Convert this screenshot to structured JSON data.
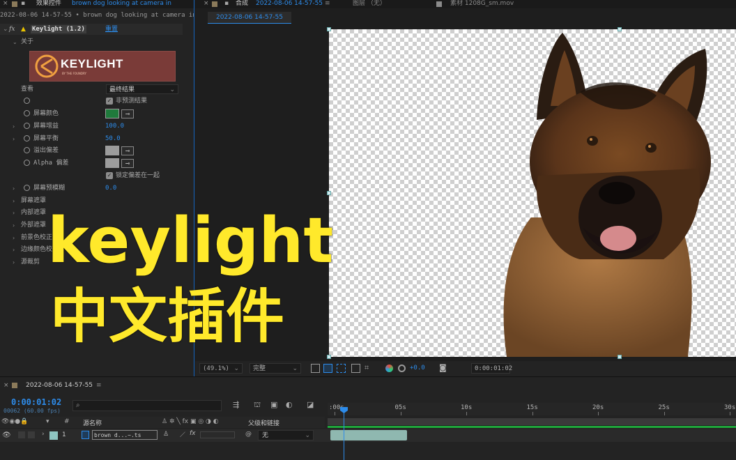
{
  "effect_controls": {
    "tab_label": "效果控件",
    "tab_source": "brown dog looking at camera in",
    "subtitle": "2022-08-06 14-57-55 • brown dog looking at camera in",
    "effect_name": "Keylight (1.2)",
    "reset_label": "重置",
    "about_label": "关于",
    "logo_text": "KEYLIGHT",
    "logo_subtext": "BY THE FOUNDRY",
    "view_label": "查看",
    "view_value": "最终结果",
    "unpremultiply_label": "非预测结果",
    "screen_colour_label": "屏幕颜色",
    "screen_colour": "#1f7a3c",
    "screen_gain_label": "屏幕增益",
    "screen_gain_value": "100.0",
    "screen_balance_label": "屏幕平衡",
    "screen_balance_value": "50.0",
    "despill_bias_label": "溢出偏差",
    "alpha_bias_label": "Alpha 偏差",
    "lock_biases_label": "锁定偏差在一起",
    "screen_preblur_label": "屏幕预模糊",
    "screen_preblur_value": "0.0",
    "screen_matte_label": "屏幕遮罩",
    "inside_mask_label": "内部遮罩",
    "outside_mask_label": "外部遮罩",
    "fg_colour_correction_label": "前景色校正",
    "edge_colour_correction_label": "边缘颜色校正",
    "source_crops_label": "源裁剪"
  },
  "composition": {
    "tab_label": "合成",
    "tab_comp_name": "2022-08-06 14-57-55",
    "layer_tab_label": "图层 （无）",
    "footage_tab_label": "素材 1208G_sm.mov",
    "subtab": "2022-08-06 14-57-55",
    "zoom": "(49.1%)",
    "resolution": "完整",
    "exposure": "+0.0",
    "timecode": "0:00:01:02"
  },
  "timeline": {
    "comp_tab": "2022-08-06 14-57-55",
    "current_time": "0:00:01:02",
    "frame_info": "00062 (60.00 fps)",
    "search_placeholder": "",
    "column_source_name": "源名称",
    "column_parent": "父级和链接",
    "layer_number": "1",
    "layer_name": "brown d...~.ts",
    "parent_value": "无",
    "ruler_ticks": [
      ":00s",
      "05s",
      "10s",
      "15s",
      "20s",
      "25s",
      "30s"
    ]
  },
  "overlay": {
    "line1": "keylight",
    "line2": "中文插件"
  },
  "colors": {
    "accent": "#2d8ceb",
    "overlay_text": "#ffe92b",
    "track_green": "#1ea53a"
  }
}
